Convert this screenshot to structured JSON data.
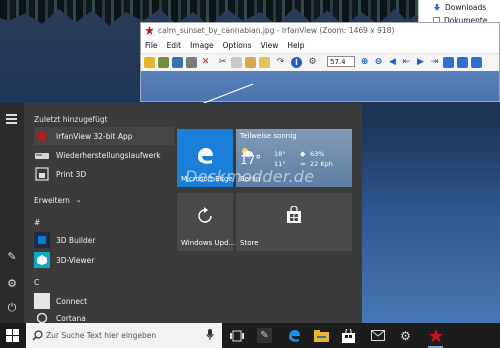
{
  "explorer": {
    "items": [
      "Downloads",
      "Dokumente"
    ]
  },
  "irfanview": {
    "title": "calm_sunset_by_cannabian.jpg - IrfanView (Zoom: 1469 x 918)",
    "menu": [
      "File",
      "Edit",
      "Image",
      "Options",
      "View",
      "Help"
    ],
    "zoom_value": "57.4"
  },
  "start_menu": {
    "recently_added_header": "Zuletzt hinzugefügt",
    "recent_apps": [
      "IrfanView 32-bit App",
      "Wiederherstellungslaufwerk",
      "Print 3D"
    ],
    "expand_label": "Erweitern",
    "letter_hash": "#",
    "hash_apps": [
      "3D Builder",
      "3D-Viewer"
    ],
    "letter_c": "C",
    "c_apps": [
      "Connect",
      "Cortana"
    ],
    "tiles": {
      "edge_label": "Microsoft Edge",
      "weather": {
        "condition": "Teilweise sonnig",
        "temp": "17°",
        "high": "18°",
        "low": "11°",
        "humidity": "63%",
        "wind": "22 Kph",
        "city": "Berlin"
      },
      "windows_update_label": "Windows Upd...",
      "store_label": "Store"
    }
  },
  "taskbar": {
    "search_placeholder": "Zur Suche Text hier eingeben"
  },
  "watermark": "Deskmodder.de"
}
